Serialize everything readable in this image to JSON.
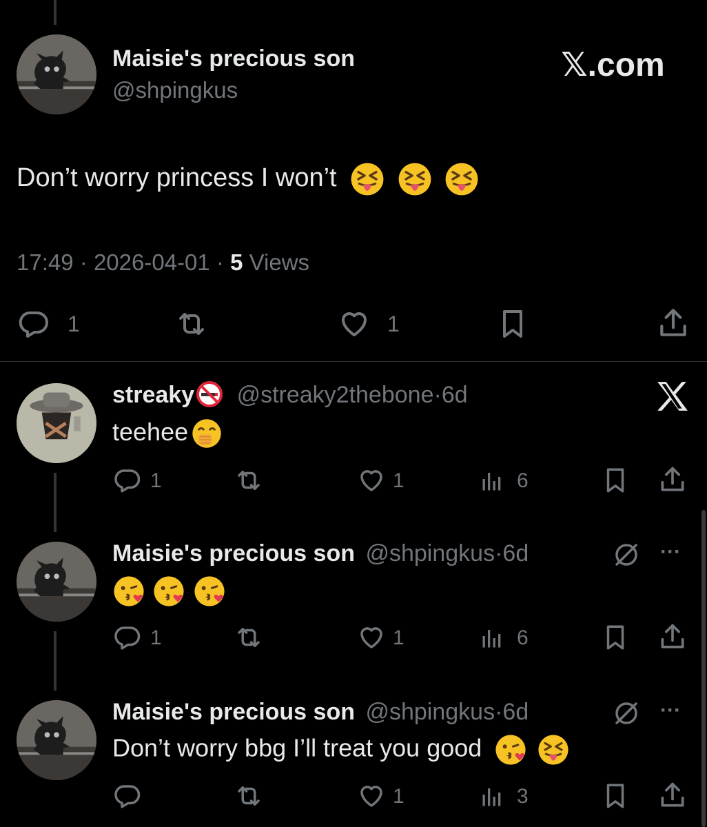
{
  "main_tweet": {
    "display_name": "Maisie's precious son",
    "handle": "@shpingkus",
    "brand": "𝕏.com",
    "text": "Don’t worry princess I won’t",
    "time": "17:49",
    "date": "2026-04-01",
    "views_count": "5",
    "views_label": "Views",
    "replies": "1",
    "likes": "1"
  },
  "replies": [
    {
      "display_name": "streaky",
      "name_emoji": "no-smoking-icon",
      "handle": "@streaky2thebone",
      "age": "6d",
      "text": "teehee",
      "replies": "1",
      "likes": "1",
      "views": "6"
    },
    {
      "display_name": "Maisie's precious son",
      "handle": "@shpingkus",
      "age": "6d",
      "text": "",
      "replies": "1",
      "likes": "1",
      "views": "6"
    },
    {
      "display_name": "Maisie's precious son",
      "handle": "@shpingkus",
      "age": "6d",
      "text": "Don’t worry bbg I’ll treat you good",
      "replies": "",
      "likes": "1",
      "views": "3"
    }
  ],
  "separator": "·",
  "more_label": "···",
  "colors": {
    "background": "#000000",
    "text": "#e7e9ea",
    "secondary": "#71767b",
    "divider": "#2f3336"
  }
}
